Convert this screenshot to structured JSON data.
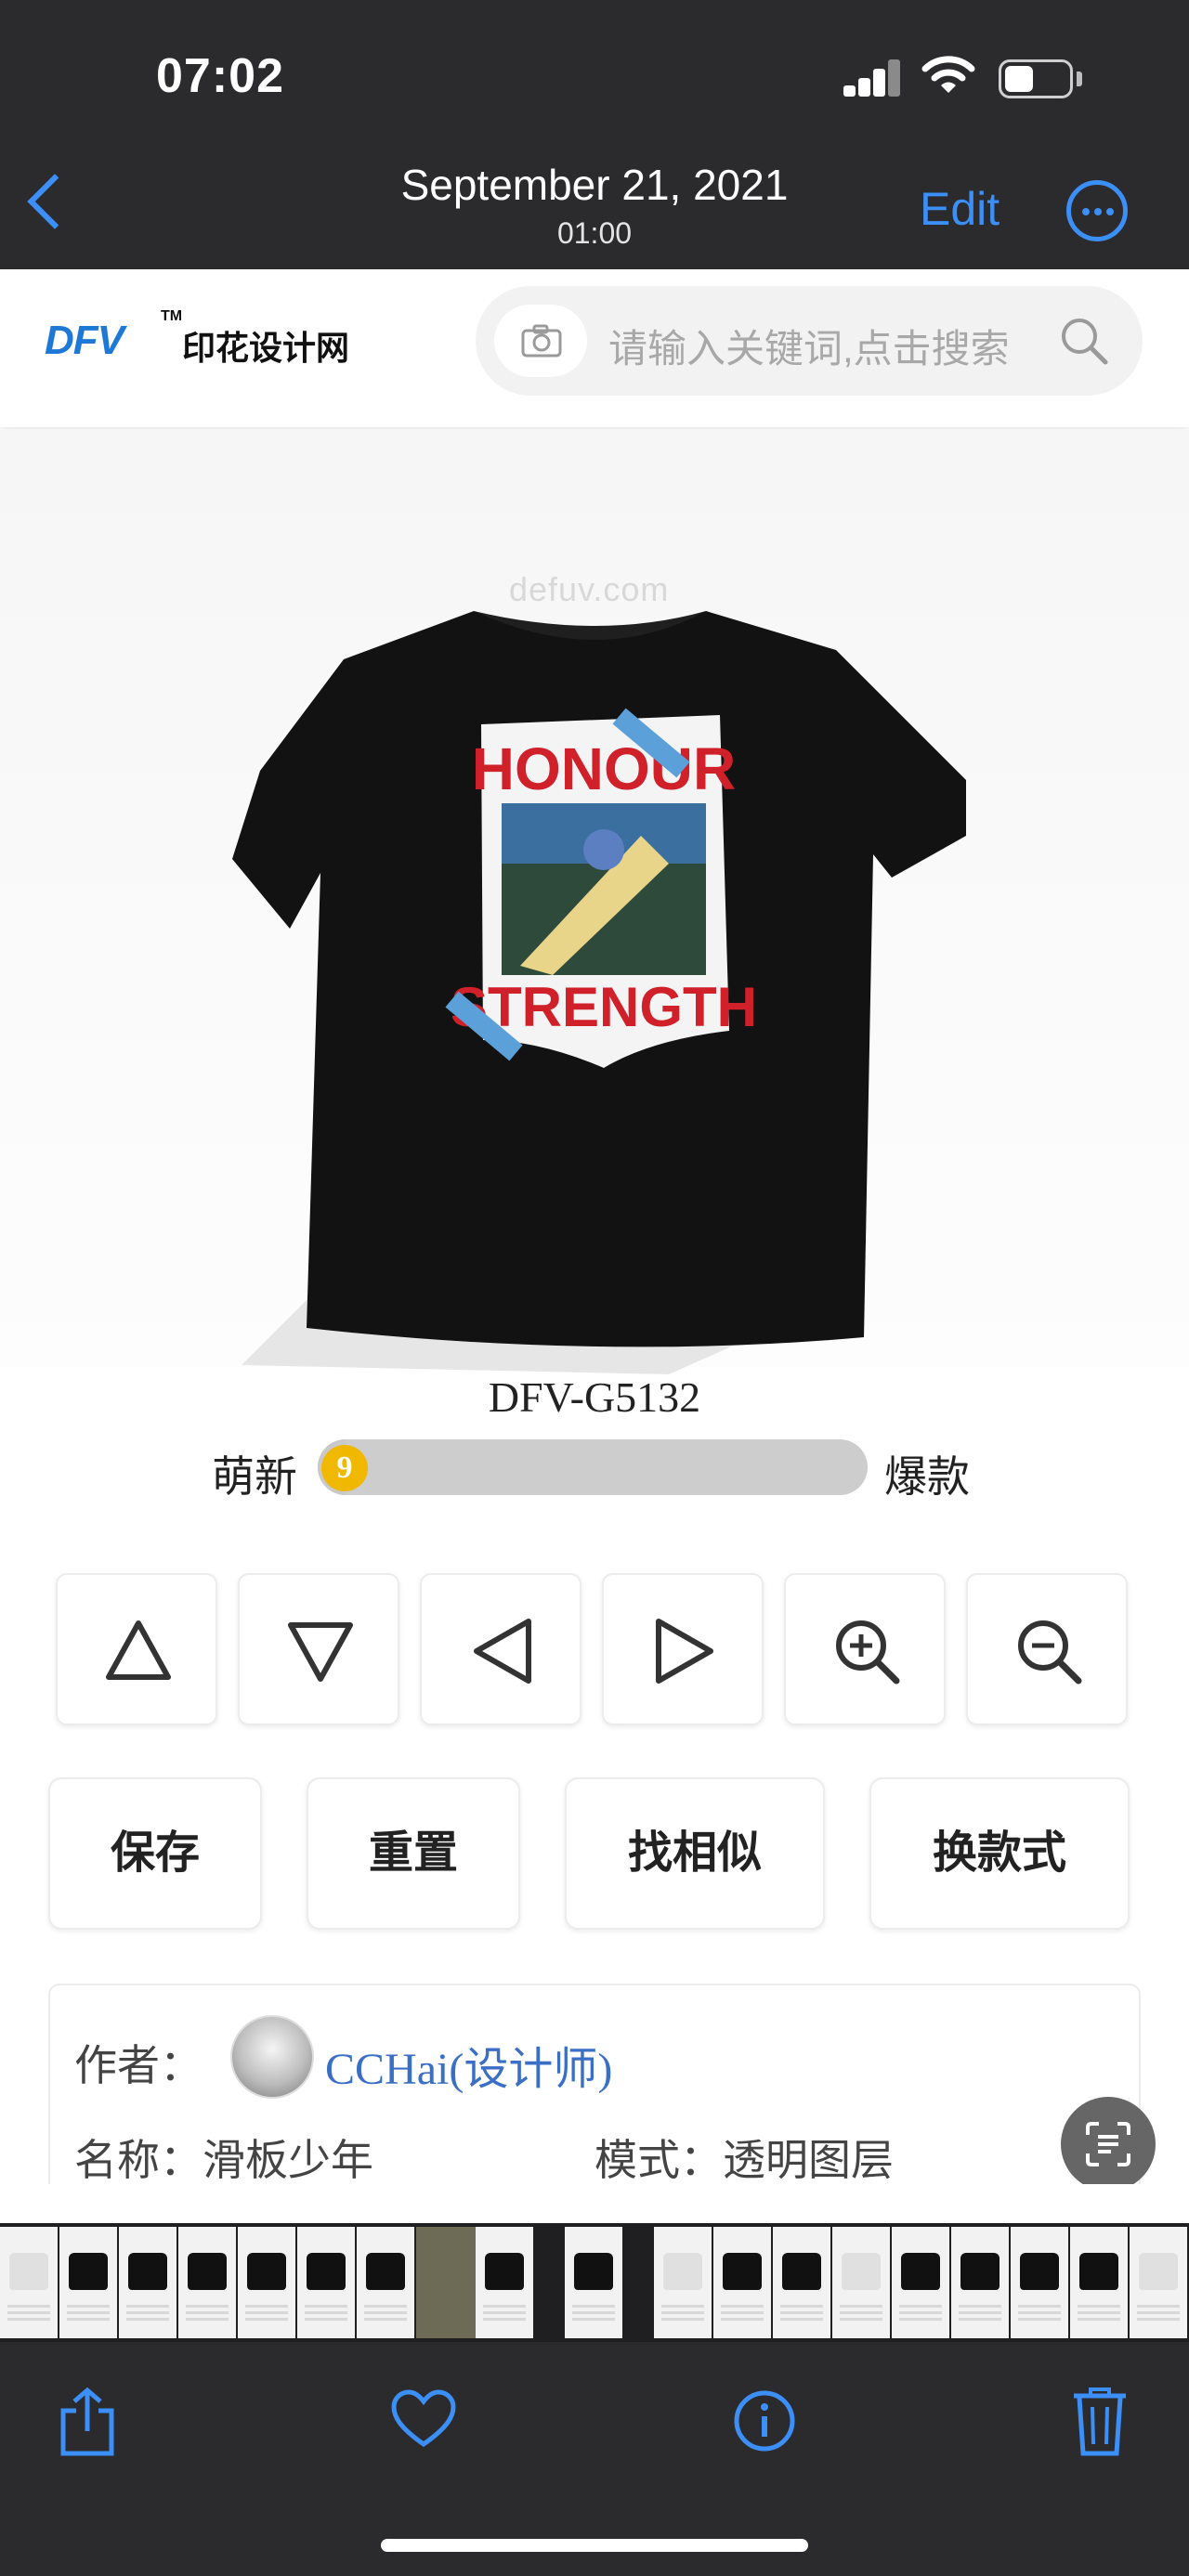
{
  "status_bar": {
    "time": "07:02",
    "battery_level": 0.35
  },
  "nav_bar": {
    "back_label": "",
    "date": "September 21, 2021",
    "time": "01:00",
    "edit_label": "Edit",
    "more_icon": "ellipsis-circle-icon"
  },
  "site": {
    "logo_text": "DFV",
    "logo_tm": "TM",
    "logo_name": "印花设计网",
    "search_placeholder": "请输入关键词,点击搜索",
    "camera_icon": "camera-icon",
    "search_icon": "search-icon"
  },
  "product": {
    "watermark": "defuv.com",
    "print_top": "HONOUR",
    "print_bottom": "STRENGTH",
    "code": "DFV-G5132",
    "level_low_label": "萌新",
    "level_high_label": "爆款",
    "level_value": "9",
    "level_fraction": 0.05
  },
  "controls": [
    {
      "name": "move-up-button",
      "icon": "triangle-up-icon"
    },
    {
      "name": "move-down-button",
      "icon": "triangle-down-icon"
    },
    {
      "name": "move-left-button",
      "icon": "triangle-left-icon"
    },
    {
      "name": "move-right-button",
      "icon": "triangle-right-icon"
    },
    {
      "name": "zoom-in-button",
      "icon": "zoom-in-icon"
    },
    {
      "name": "zoom-out-button",
      "icon": "zoom-out-icon"
    }
  ],
  "actions": {
    "save": "保存",
    "reset": "重置",
    "find_similar": "找相似",
    "change_style": "换款式"
  },
  "info": {
    "author_label": "作者：",
    "author_name": "CCHai(设计师)",
    "name_line": "名称：滑板少年",
    "mode_line": "模式：透明图层"
  },
  "toolbar": {
    "share_icon": "share-icon",
    "favorite_icon": "heart-icon",
    "info_icon": "info-icon",
    "delete_icon": "trash-icon"
  },
  "colors": {
    "ios_blue": "#3b8ff7",
    "brand_blue": "#1e78d6",
    "print_red": "#d0202a",
    "author_link": "#3b6fc6"
  }
}
